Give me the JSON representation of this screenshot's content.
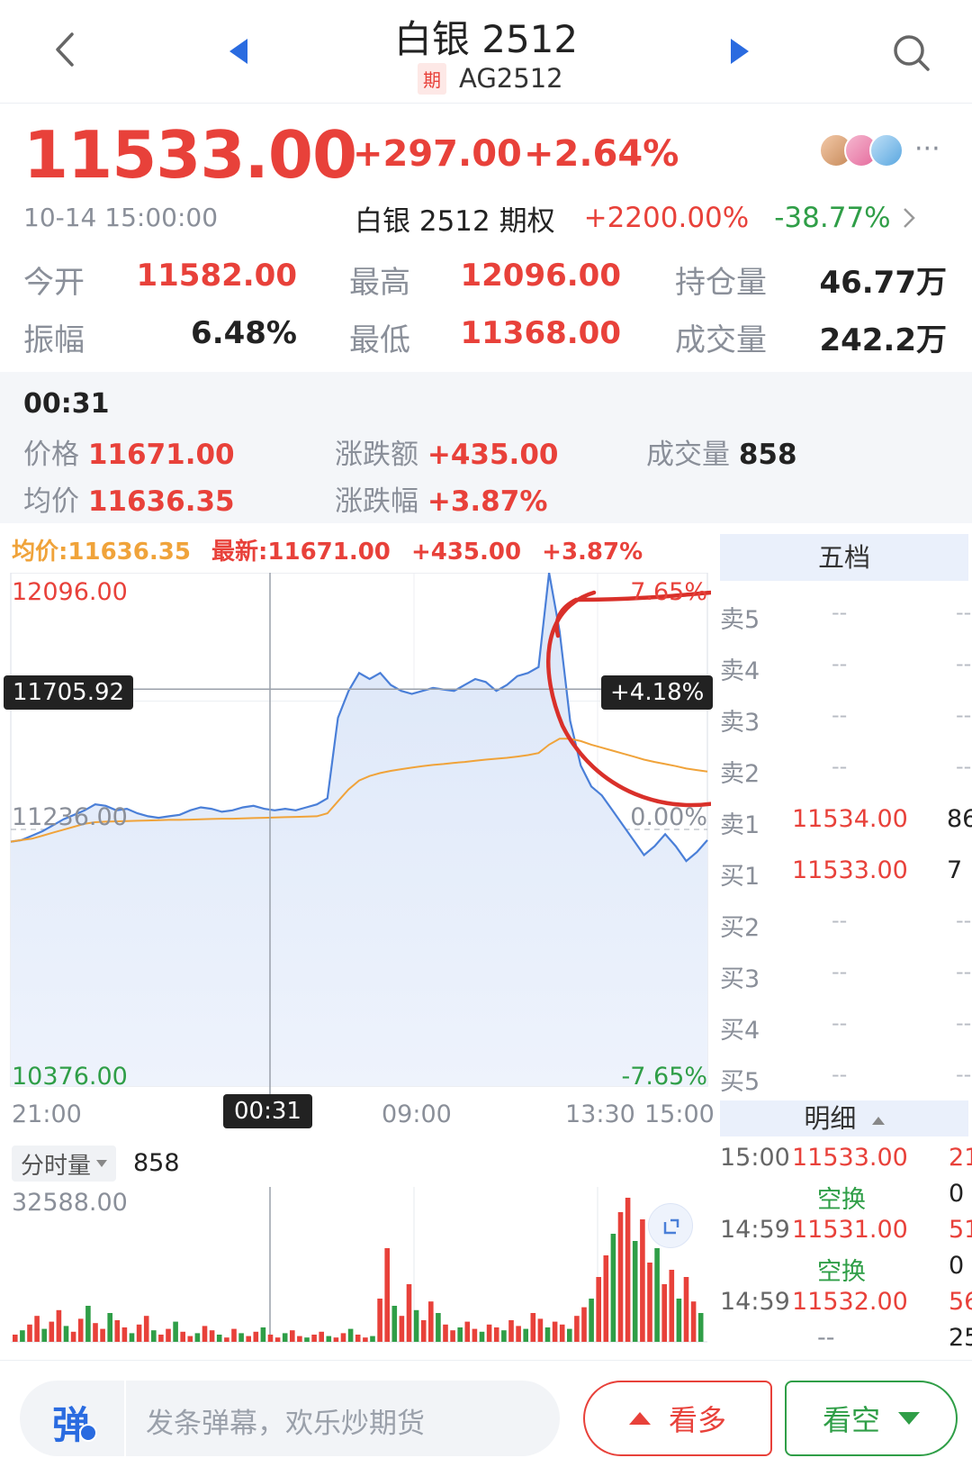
{
  "header": {
    "title": "白银 2512",
    "badge": "期",
    "code": "AG2512"
  },
  "quote": {
    "price": "11533.00",
    "change": "+297.00",
    "change_pct": "+2.64%",
    "time": "10-14 15:00:00",
    "option_label": "白银 2512 期权",
    "option_pct1": "+2200.00%",
    "option_pct2": "-38.77%",
    "more": "···",
    "stats": [
      {
        "label": "今开",
        "value": "11582.00"
      },
      {
        "label": "最高",
        "value": "12096.00"
      },
      {
        "label": "持仓量",
        "value": "46.77万"
      },
      {
        "label": "振幅",
        "value": "6.48%"
      },
      {
        "label": "最低",
        "value": "11368.00"
      },
      {
        "label": "成交量",
        "value": "242.2万"
      }
    ]
  },
  "info": {
    "time": "00:31",
    "price_label": "价格",
    "price": "11671.00",
    "chg_label": "涨跌额",
    "chg": "+435.00",
    "vol_label": "成交量",
    "vol": "858",
    "avg_label": "均价",
    "avg": "11636.35",
    "pct_label": "涨跌幅",
    "pct": "+3.87%"
  },
  "legend": {
    "avg": "均价:11636.35",
    "last": "最新:11671.00",
    "chg": "+435.00",
    "pct": "+3.87%"
  },
  "chart_data": {
    "type": "line",
    "y_labels": {
      "top": "12096.00",
      "mid": "11236.00",
      "bottom": "10376.00"
    },
    "pct_labels": {
      "top": "7.65%",
      "mid": "0.00%",
      "bottom": "-7.65%"
    },
    "x_ticks": [
      "21:00",
      "09:00",
      "13:30",
      "15:00"
    ],
    "cursor_x_label": "00:31",
    "cursor_y_label": "11705.92",
    "cursor_pct_label": "+4.18%",
    "ylim": [
      10376,
      12096
    ],
    "series": [
      {
        "values": [
          11195,
          11200,
          11215,
          11230,
          11250,
          11270,
          11285,
          11300,
          11320,
          11315,
          11300,
          11305,
          11290,
          11280,
          11275,
          11280,
          11285,
          11300,
          11310,
          11305,
          11295,
          11300,
          11310,
          11315,
          11305,
          11300,
          11305,
          11300,
          11310,
          11320,
          11340,
          11610,
          11700,
          11760,
          11740,
          11760,
          11720,
          11700,
          11690,
          11700,
          11710,
          11705,
          11700,
          11720,
          11740,
          11730,
          11700,
          11720,
          11750,
          11760,
          11780,
          12096,
          11900,
          11600,
          11450,
          11380,
          11350,
          11300,
          11250,
          11200,
          11150,
          11180,
          11220,
          11180,
          11130,
          11160,
          11200
        ]
      },
      {
        "values": [
          11195,
          11200,
          11205,
          11215,
          11225,
          11235,
          11245,
          11255,
          11260,
          11262,
          11263,
          11264,
          11265,
          11266,
          11267,
          11268,
          11268,
          11269,
          11270,
          11271,
          11272,
          11272,
          11273,
          11274,
          11275,
          11276,
          11277,
          11278,
          11279,
          11280,
          11290,
          11330,
          11370,
          11400,
          11415,
          11425,
          11432,
          11438,
          11443,
          11448,
          11452,
          11455,
          11459,
          11462,
          11466,
          11470,
          11473,
          11476,
          11480,
          11485,
          11492,
          11520,
          11540,
          11540,
          11532,
          11520,
          11510,
          11500,
          11490,
          11480,
          11470,
          11462,
          11455,
          11448,
          11440,
          11435,
          11430
        ]
      }
    ]
  },
  "volume": {
    "tab": "分时量",
    "value": "858",
    "max_label": "32588.00",
    "bars": [
      5,
      8,
      12,
      18,
      9,
      14,
      22,
      11,
      7,
      16,
      25,
      13,
      9,
      20,
      15,
      10,
      6,
      12,
      18,
      8,
      5,
      9,
      14,
      7,
      4,
      6,
      11,
      8,
      5,
      3,
      9,
      6,
      4,
      7,
      10,
      5,
      3,
      6,
      8,
      4,
      3,
      5,
      7,
      4,
      3,
      6,
      9,
      5,
      3,
      4,
      30,
      65,
      25,
      18,
      40,
      22,
      15,
      28,
      20,
      12,
      8,
      10,
      14,
      9,
      7,
      12,
      10,
      8,
      15,
      11,
      9,
      20,
      16,
      10,
      14,
      12,
      9,
      18,
      24,
      30,
      45,
      60,
      75,
      90,
      100,
      70,
      85,
      55,
      65,
      40,
      50,
      30,
      45,
      28,
      20
    ]
  },
  "orderbook": {
    "title": "五档",
    "rows": [
      {
        "label": "卖5",
        "price": "--",
        "vol": "--"
      },
      {
        "label": "卖4",
        "price": "--",
        "vol": "--"
      },
      {
        "label": "卖3",
        "price": "--",
        "vol": "--"
      },
      {
        "label": "卖2",
        "price": "--",
        "vol": "--"
      },
      {
        "label": "卖1",
        "price": "11534.00",
        "vol": "86"
      },
      {
        "label": "买1",
        "price": "11533.00",
        "vol": "7"
      },
      {
        "label": "买2",
        "price": "--",
        "vol": "--"
      },
      {
        "label": "买3",
        "price": "--",
        "vol": "--"
      },
      {
        "label": "买4",
        "price": "--",
        "vol": "--"
      },
      {
        "label": "买5",
        "price": "--",
        "vol": "--"
      }
    ]
  },
  "detail": {
    "title": "明细",
    "rows": [
      {
        "time": "15:00",
        "price": "11533.00",
        "vol": "21"
      },
      {
        "time": "",
        "price": "空换",
        "vol": "0"
      },
      {
        "time": "14:59",
        "price": "11531.00",
        "vol": "51"
      },
      {
        "time": "",
        "price": "空换",
        "vol": "0"
      },
      {
        "time": "14:59",
        "price": "11532.00",
        "vol": "56"
      },
      {
        "time": "",
        "price": "--",
        "vol": "25"
      }
    ]
  },
  "bottom": {
    "danmu_icon": "弹",
    "danmu_placeholder": "发条弹幕，欢乐炒期货",
    "bull_label": "看多",
    "bear_label": "看空"
  },
  "colors": {
    "up": "#e8413a",
    "down": "#2f9e47",
    "price_line": "#4a7fd8",
    "avg_line": "#f0a33a",
    "annotation": "#d9302a"
  }
}
